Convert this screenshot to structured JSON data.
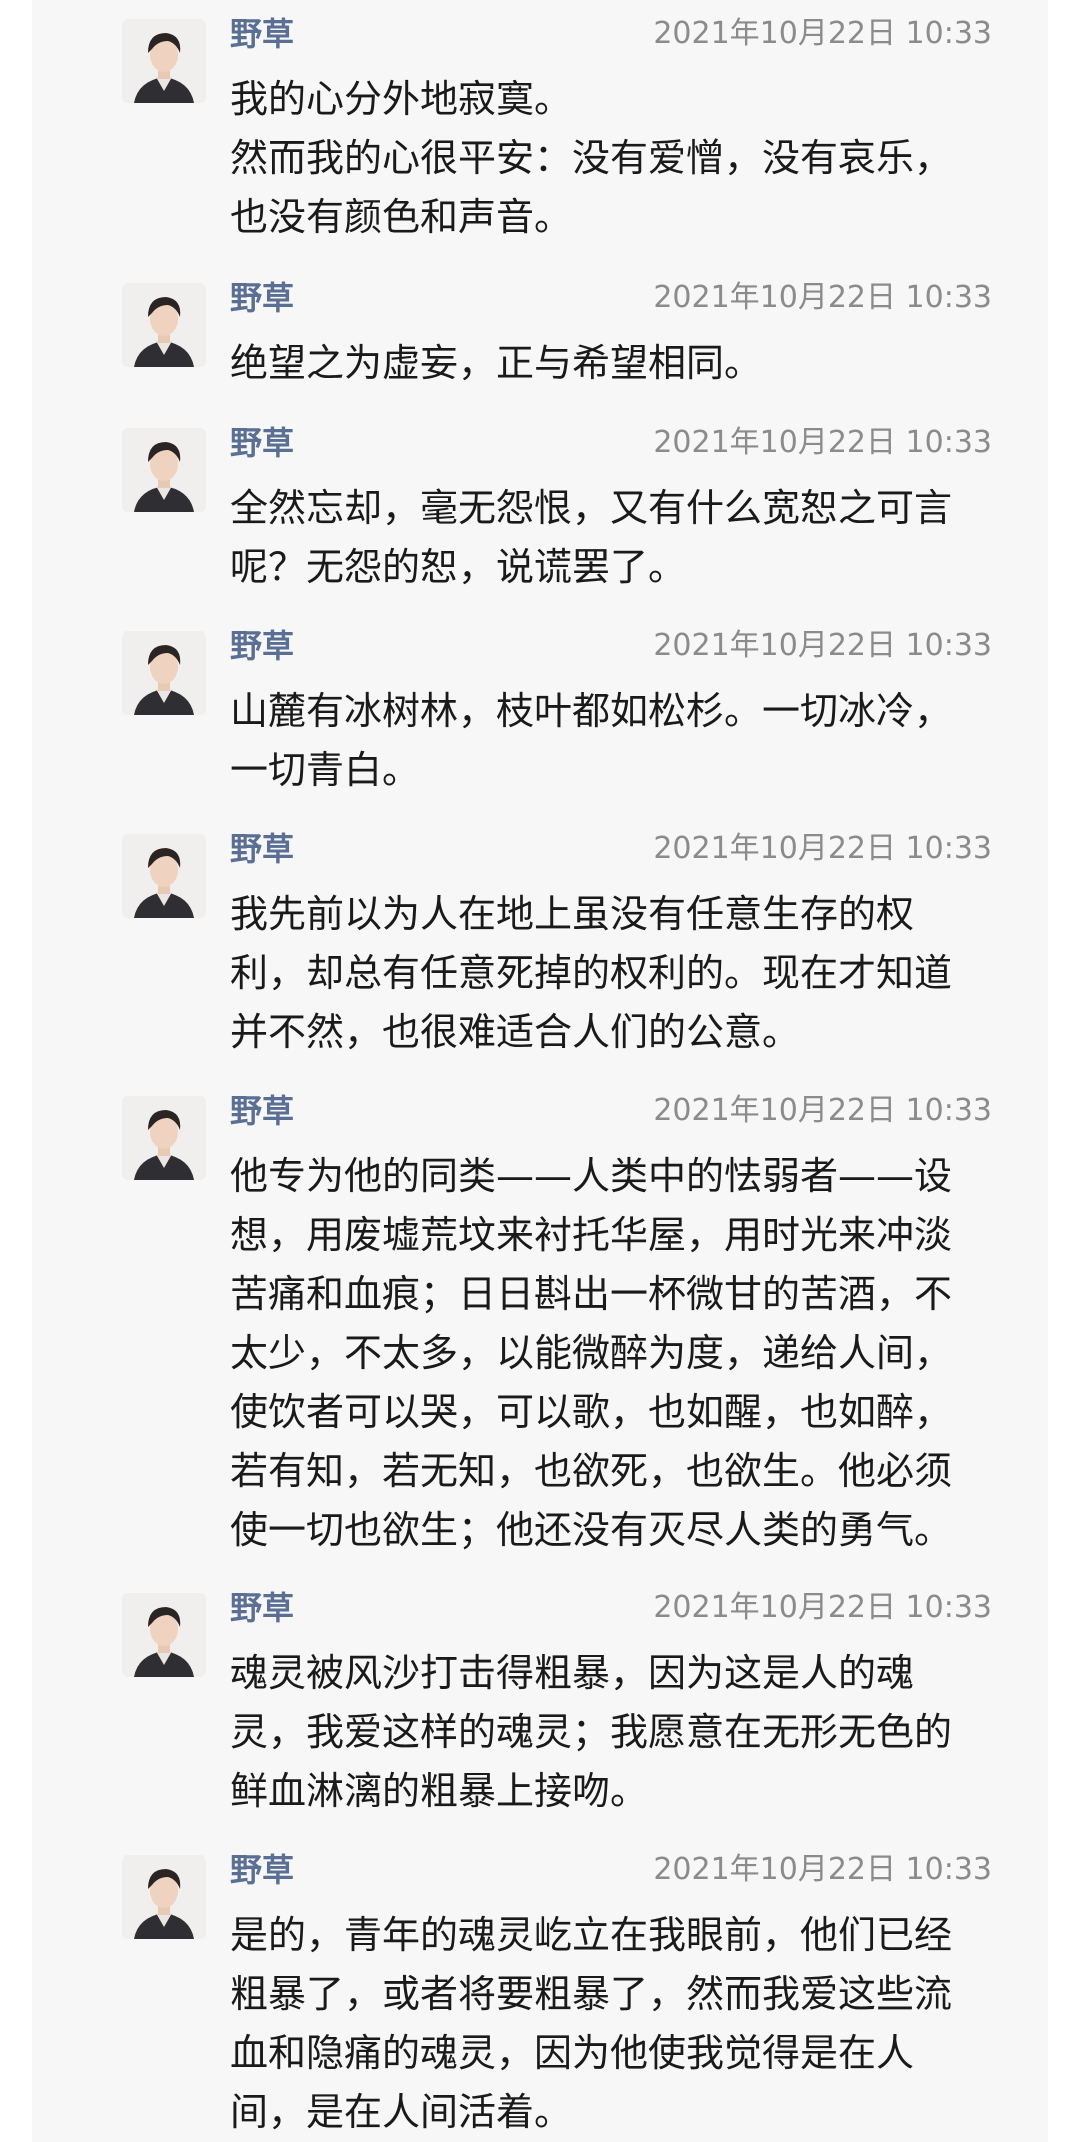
{
  "messages": [
    {
      "sender": "野草",
      "time": "2021年10月22日 10:33",
      "lines": [
        "我的心分外地寂寞。",
        "然而我的心很平安：没有爱憎，没有哀乐，",
        "也没有颜色和声音。"
      ]
    },
    {
      "sender": "野草",
      "time": "2021年10月22日 10:33",
      "lines": [
        "绝望之为虚妄，正与希望相同。"
      ]
    },
    {
      "sender": "野草",
      "time": "2021年10月22日 10:33",
      "lines": [
        "全然忘却，毫无怨恨，又有什么宽恕之可言",
        "呢？无怨的恕，说谎罢了。"
      ]
    },
    {
      "sender": "野草",
      "time": "2021年10月22日 10:33",
      "lines": [
        "山麓有冰树林，枝叶都如松杉。一切冰冷，",
        "一切青白。"
      ]
    },
    {
      "sender": "野草",
      "time": "2021年10月22日 10:33",
      "lines": [
        "我先前以为人在地上虽没有任意生存的权",
        "利，却总有任意死掉的权利的。现在才知道",
        "并不然，也很难适合人们的公意。"
      ]
    },
    {
      "sender": "野草",
      "time": "2021年10月22日 10:33",
      "lines": [
        "他专为他的同类——人类中的怯弱者——设",
        "想，用废墟荒坟来衬托华屋，用时光来冲淡",
        "苦痛和血痕；日日斟出一杯微甘的苦酒，不",
        "太少，不太多，以能微醉为度，递给人间，",
        "使饮者可以哭，可以歌，也如醒，也如醉，",
        "若有知，若无知，也欲死，也欲生。他必须",
        "使一切也欲生；他还没有灭尽人类的勇气。"
      ]
    },
    {
      "sender": "野草",
      "time": "2021年10月22日 10:33",
      "lines": [
        "魂灵被风沙打击得粗暴，因为这是人的魂",
        "灵，我爱这样的魂灵；我愿意在无形无色的",
        "鲜血淋漓的粗暴上接吻。"
      ]
    },
    {
      "sender": "野草",
      "time": "2021年10月22日 10:33",
      "lines": [
        "是的，青年的魂灵屹立在我眼前，他们已经",
        "粗暴了，或者将要粗暴了，然而我爱这些流",
        "血和隐痛的魂灵，因为他使我觉得是在人",
        "间，是在人间活着。"
      ]
    }
  ]
}
